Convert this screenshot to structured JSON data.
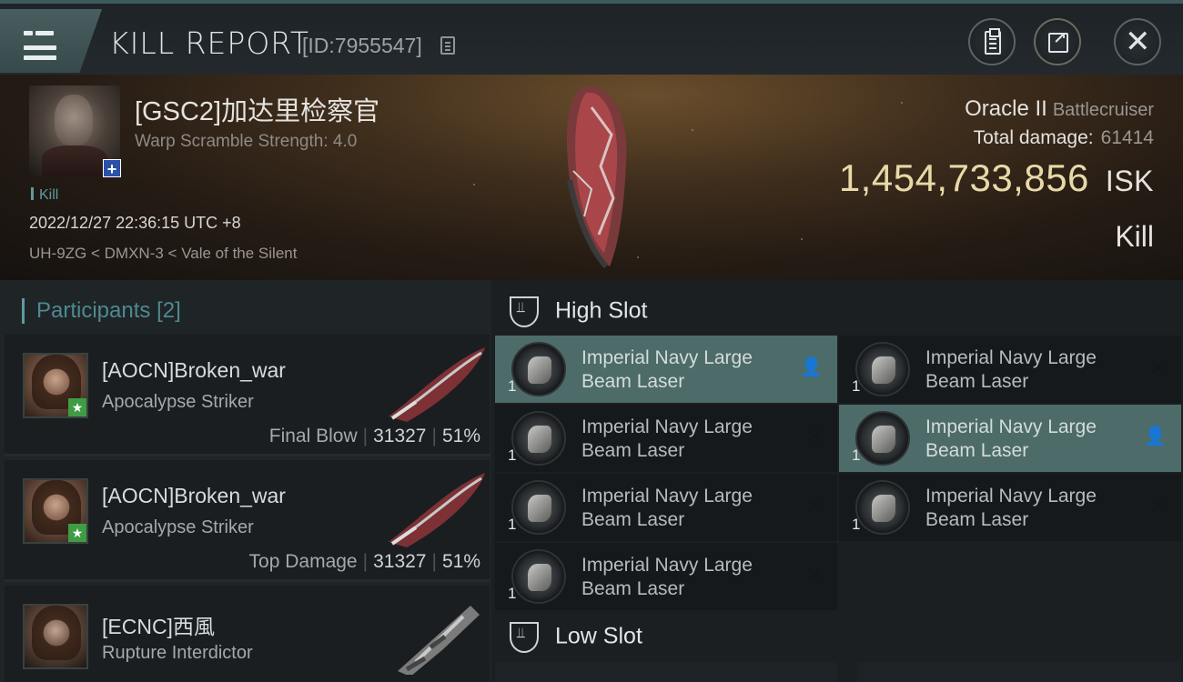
{
  "header": {
    "title": "KILL REPORT",
    "report_id": "[ID:7955547]"
  },
  "victim": {
    "name": "[GSC2]加达里检察官",
    "warp_scramble": "Warp Scramble Strength: 4.0",
    "result_tag": "Kill",
    "datetime": "2022/12/27 22:36:15 UTC +8",
    "location": "UH-9ZG < DMXN-3 < Vale of the Silent",
    "ship_name": "Oracle II",
    "ship_class": "Battlecruiser",
    "total_damage_label": "Total damage:",
    "total_damage_value": "61414",
    "isk_value": "1,454,733,856",
    "isk_unit": "ISK",
    "result_big": "Kill"
  },
  "participants": {
    "title": "Participants",
    "count": "[2]",
    "items": [
      {
        "name": "[AOCN]Broken_war",
        "ship": "Apocalypse Striker",
        "role": "Final Blow",
        "damage": "31327",
        "percent": "51%"
      },
      {
        "name": "[AOCN]Broken_war",
        "ship": "Apocalypse Striker",
        "role": "Top Damage",
        "damage": "31327",
        "percent": "51%"
      },
      {
        "name": "[ECNC]西風",
        "ship": "Rupture Interdictor"
      }
    ]
  },
  "modules": {
    "high_slot_label": "High Slot",
    "low_slot_label": "Low Slot",
    "high_slot": [
      {
        "line1": "Imperial Navy Large",
        "line2": "Beam Laser",
        "qty": "1",
        "state": "dropped"
      },
      {
        "line1": "Imperial Navy Large",
        "line2": "Beam Laser",
        "qty": "1",
        "state": "destroyed"
      },
      {
        "line1": "Imperial Navy Large",
        "line2": "Beam Laser",
        "qty": "1",
        "state": "destroyed"
      },
      {
        "line1": "Imperial Navy Large",
        "line2": "Beam Laser",
        "qty": "1",
        "state": "dropped"
      },
      {
        "line1": "Imperial Navy Large",
        "line2": "Beam Laser",
        "qty": "1",
        "state": "destroyed"
      },
      {
        "line1": "Imperial Navy Large",
        "line2": "Beam Laser",
        "qty": "1",
        "state": "destroyed"
      },
      {
        "line1": "Imperial Navy Large",
        "line2": "Beam Laser",
        "qty": "1",
        "state": "destroyed"
      }
    ]
  },
  "colors": {
    "accent_teal": "#5f9aa0",
    "isk_gold": "#e8d9a8",
    "active_slot": "#4d6b69"
  },
  "icons": [
    "menu-icon",
    "copy-icon",
    "clipboard-icon",
    "share-icon",
    "close-icon",
    "person-icon",
    "x-icon",
    "slot-icon"
  ]
}
